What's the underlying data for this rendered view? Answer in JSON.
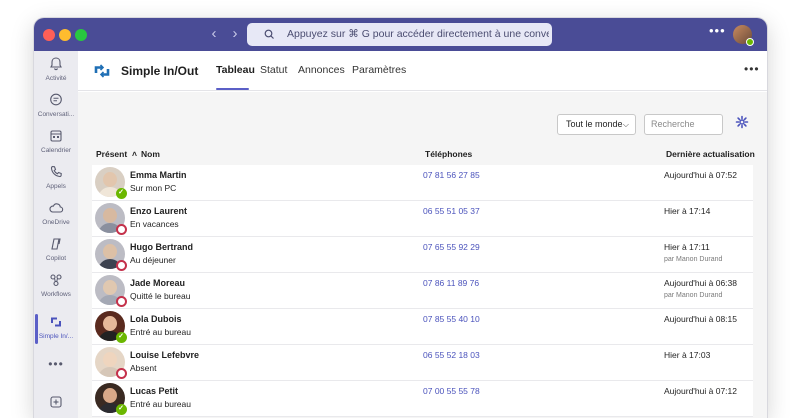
{
  "titlebar": {
    "search_icon": "search-icon",
    "search_text": "Appuyez sur ⌘ G pour accéder directement à une conversatio"
  },
  "rail": {
    "items": [
      {
        "label": "Activité",
        "icon": "bell-icon"
      },
      {
        "label": "Conversati...",
        "icon": "chat-icon"
      },
      {
        "label": "Calendrier",
        "icon": "calendar-icon"
      },
      {
        "label": "Appels",
        "icon": "phone-icon"
      },
      {
        "label": "OneDrive",
        "icon": "cloud-icon"
      },
      {
        "label": "Copilot",
        "icon": "copilot-icon"
      },
      {
        "label": "Workflows",
        "icon": "workflow-icon"
      },
      {
        "label": "Simple In/...",
        "icon": "app-icon"
      }
    ]
  },
  "app": {
    "title": "Simple In/Out",
    "tabs": [
      "Tableau",
      "Statut",
      "Annonces",
      "Paramètres"
    ],
    "active_tab": "Tableau"
  },
  "toolbar": {
    "filter_value": "Tout le monde",
    "search_placeholder": "Recherche"
  },
  "table": {
    "headers": {
      "present": "Présent",
      "name": "Nom",
      "phones": "Téléphones",
      "updated": "Dernière actualisation"
    },
    "rows": [
      {
        "name": "Emma Martin",
        "status_text": "Sur mon PC",
        "present": true,
        "phone": "07 81 56 27 85",
        "updated": "Aujourd'hui à 07:52",
        "by": ""
      },
      {
        "name": "Enzo Laurent",
        "status_text": "En vacances",
        "present": false,
        "phone": "06 55 51 05 37",
        "updated": "Hier à 17:14",
        "by": ""
      },
      {
        "name": "Hugo Bertrand",
        "status_text": "Au déjeuner",
        "present": false,
        "phone": "07 65 55 92 29",
        "updated": "Hier à 17:11",
        "by": "par Manon Durand"
      },
      {
        "name": "Jade Moreau",
        "status_text": "Quitté le bureau",
        "present": false,
        "phone": "07 86 11 89 76",
        "updated": "Aujourd'hui à 06:38",
        "by": "par Manon Durand"
      },
      {
        "name": "Lola Dubois",
        "status_text": "Entré au bureau",
        "present": true,
        "phone": "07 85 55 40 10",
        "updated": "Aujourd'hui à 08:15",
        "by": ""
      },
      {
        "name": "Louise Lefebvre",
        "status_text": "Absent",
        "present": false,
        "phone": "06 55 52 18 03",
        "updated": "Hier à 17:03",
        "by": ""
      },
      {
        "name": "Lucas Petit",
        "status_text": "Entré au bureau",
        "present": true,
        "phone": "07 00 55 55 78",
        "updated": "Aujourd'hui à 07:12",
        "by": ""
      }
    ]
  },
  "colors": {
    "titlebar": "#4a4c96",
    "accent": "#5b5fc7",
    "present": "#6bb700",
    "absent": "#c4314b"
  }
}
